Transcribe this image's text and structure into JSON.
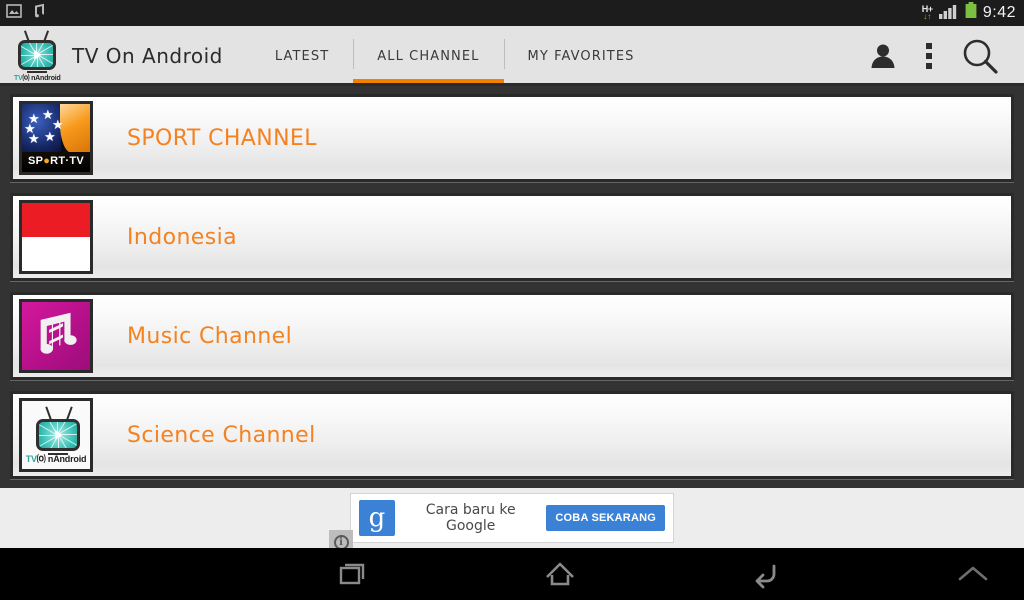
{
  "statusbar": {
    "left_icons": [
      {
        "name": "gallery-image-icon"
      },
      {
        "name": "music-note-icon"
      }
    ],
    "network_type": "H+",
    "network_arrows": "↓↑",
    "time": "9:42",
    "icons": [
      "signal-bars-icon",
      "battery-icon"
    ],
    "battery_color": "#7bc043",
    "background": "#1c1c1c"
  },
  "actionbar": {
    "app_title": "TV On Android",
    "logo_label_tv": "TV",
    "logo_label_on": "⒪ n",
    "logo_label_android": "Android",
    "tabs": [
      {
        "label": "LATEST",
        "active": false
      },
      {
        "label": "ALL CHANNEL",
        "active": true
      },
      {
        "label": "MY FAVORITES",
        "active": false
      }
    ],
    "accent_color": "#f28100",
    "background": "#e3e3e3",
    "actions": [
      {
        "name": "profile-icon"
      },
      {
        "name": "overflow-menu-icon"
      },
      {
        "name": "search-icon"
      }
    ]
  },
  "channel_list": {
    "background": "#333333",
    "label_color": "#f58220",
    "rows": [
      {
        "label": "SPORT CHANNEL",
        "thumb": "sport-tv-thumbnail",
        "thumb_text": "SPORT·TV"
      },
      {
        "label": "Indonesia",
        "thumb": "indonesia-flag-thumbnail",
        "thumb_text": ""
      },
      {
        "label": "Music Channel",
        "thumb": "music-note-thumbnail",
        "thumb_text": ""
      },
      {
        "label": "Science Channel",
        "thumb": "tv-on-android-thumbnail",
        "thumb_text": "TV ⒪ n Android"
      }
    ]
  },
  "ad": {
    "logo_letter": "g",
    "text": "Cara baru ke Google",
    "cta_label": "COBA SEKARANG",
    "info_glyph": "i",
    "button_color": "#3b82d6",
    "zone_background": "#ededed"
  },
  "navbar": {
    "buttons": [
      {
        "name": "recents-button"
      },
      {
        "name": "home-button"
      },
      {
        "name": "back-button"
      },
      {
        "name": "expand-up-button"
      }
    ],
    "background": "#000000"
  }
}
